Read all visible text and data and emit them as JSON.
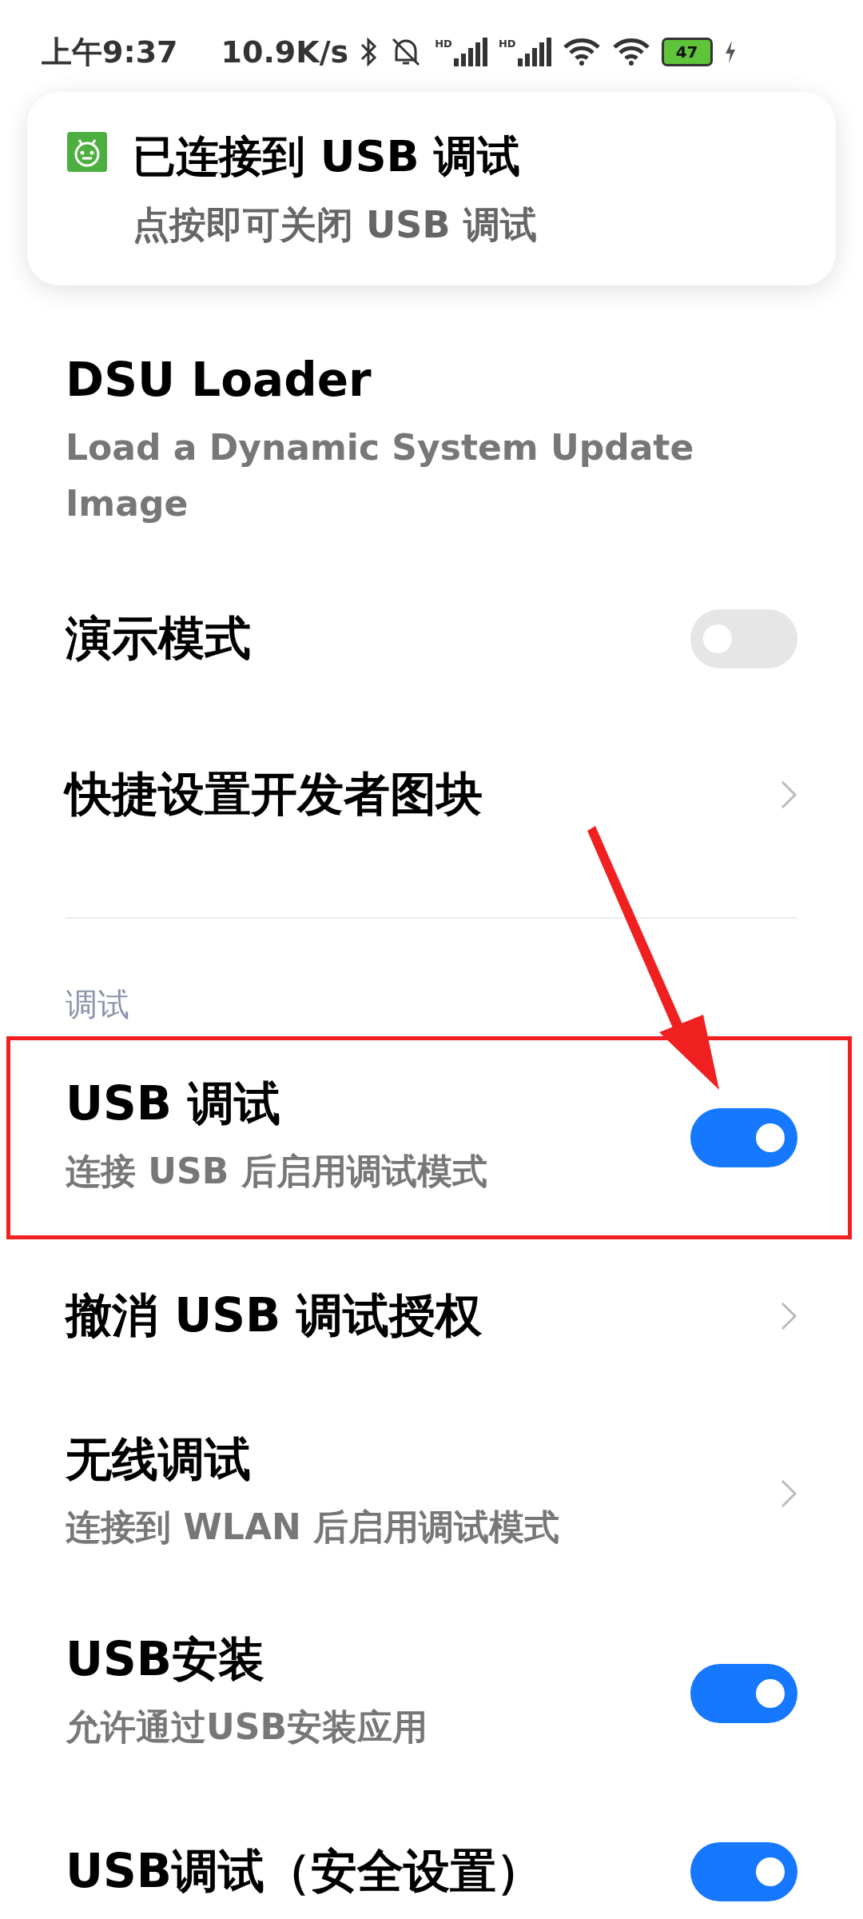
{
  "status_bar": {
    "time": "上午9:37",
    "net_speed": "10.9K/s",
    "signal_label_1": "HD",
    "signal_label_2": "HD",
    "battery": "47"
  },
  "notification": {
    "title": "已连接到 USB 调试",
    "text": "点按即可关闭 USB 调试"
  },
  "items": [
    {
      "kind": "plain",
      "title": "DSU Loader",
      "subtitle": "Load a Dynamic System Update Image"
    },
    {
      "kind": "toggle",
      "title": "演示模式",
      "on": false
    },
    {
      "kind": "link",
      "title": "快捷设置开发者图块"
    },
    {
      "kind": "divider"
    },
    {
      "kind": "section",
      "title": "调试"
    },
    {
      "kind": "toggle",
      "title": "USB 调试",
      "subtitle": "连接 USB 后启用调试模式",
      "on": true,
      "highlighted": true
    },
    {
      "kind": "link",
      "title": "撤消 USB 调试授权"
    },
    {
      "kind": "link",
      "title": "无线调试",
      "subtitle": "连接到 WLAN 后启用调试模式"
    },
    {
      "kind": "toggle",
      "title": "USB安装",
      "subtitle": "允许通过USB安装应用",
      "on": true
    },
    {
      "kind": "toggle",
      "title": "USB调试（安全设置）",
      "on": true
    }
  ]
}
